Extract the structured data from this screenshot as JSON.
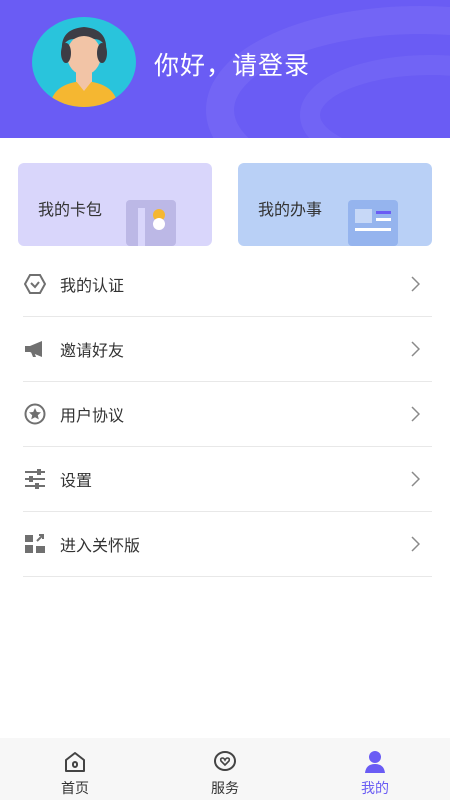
{
  "header": {
    "greeting": "你好，请登录",
    "bg_color": "#6a5cf4"
  },
  "cards": [
    {
      "label": "我的卡包",
      "bg_color": "#d9d6fb",
      "icon": "card-icon"
    },
    {
      "label": "我的办事",
      "bg_color": "#b9d0f6",
      "icon": "document-icon"
    }
  ],
  "menu": [
    {
      "label": "我的认证",
      "icon": "shield-check-icon"
    },
    {
      "label": "邀请好友",
      "icon": "megaphone-icon"
    },
    {
      "label": "用户协议",
      "icon": "star-badge-icon"
    },
    {
      "label": "设置",
      "icon": "sliders-icon"
    },
    {
      "label": "进入关怀版",
      "icon": "care-mode-icon"
    }
  ],
  "tabbar": {
    "tabs": [
      {
        "label": "首页",
        "icon": "home-icon",
        "active": false
      },
      {
        "label": "服务",
        "icon": "heart-chat-icon",
        "active": false
      },
      {
        "label": "我的",
        "icon": "user-icon",
        "active": true
      }
    ],
    "active_color": "#6a5cf4"
  }
}
